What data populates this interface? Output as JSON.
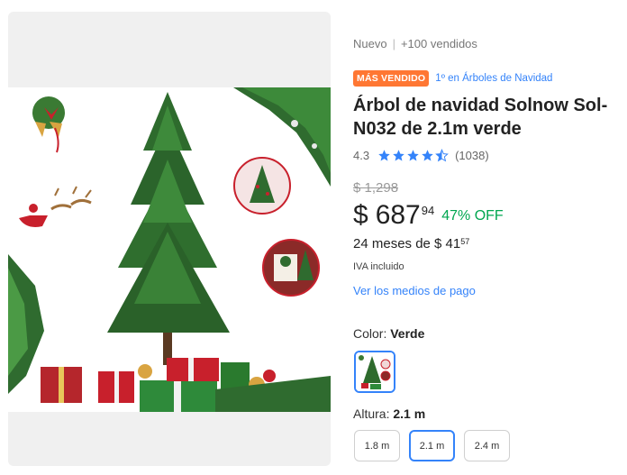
{
  "meta": {
    "condition": "Nuevo",
    "separator": "|",
    "sold": "+100 vendidos"
  },
  "badge": {
    "label": "MÁS VENDIDO",
    "rank": "1º en Árboles de Navidad"
  },
  "product": {
    "title": "Árbol de navidad Solnow Sol-N032 de 2.1m verde"
  },
  "rating": {
    "score": "4.3",
    "stars": 4.3,
    "count": "(1038)"
  },
  "price": {
    "original": "$ 1,298",
    "currency": "$",
    "integer": "687",
    "cents": "94",
    "discount": "47% OFF"
  },
  "installments": {
    "text": "24 meses de $ 41",
    "cents": "57"
  },
  "tax_note": "IVA incluido",
  "payment_link": "Ver los medios de pago",
  "color": {
    "label": "Color: ",
    "value": "Verde"
  },
  "size": {
    "label": "Altura: ",
    "value": "2.1 m",
    "options": [
      "1.8 m",
      "2.1 m",
      "2.4 m"
    ],
    "selected": 1
  },
  "colors": {
    "accent": "#3483fa",
    "badge": "#ff7733",
    "discount": "#00a650"
  }
}
